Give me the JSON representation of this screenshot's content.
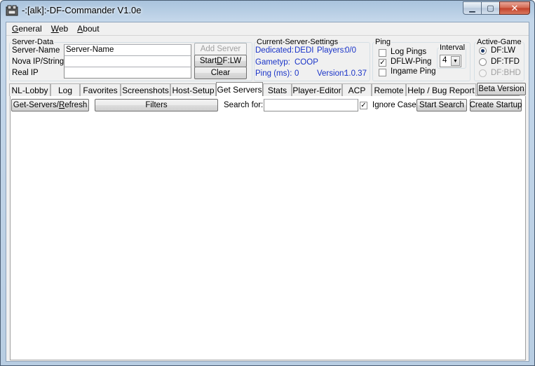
{
  "window": {
    "title": "-:[alk]:-DF-Commander V1.0e"
  },
  "menu": [
    {
      "pre": "",
      "u": "G",
      "post": "eneral"
    },
    {
      "pre": "",
      "u": "W",
      "post": "eb"
    },
    {
      "pre": "",
      "u": "A",
      "post": "bout"
    }
  ],
  "server_data": {
    "legend": "Server-Data",
    "name_label": "Server-Name",
    "name_value": "Server-Name",
    "nova_label": "Nova IP/String",
    "nova_value": "",
    "realip_label": "Real IP",
    "realip_value": "",
    "add_button": "Add Server",
    "start_button_pre": "Start ",
    "start_button_u": "D",
    "start_button_post": "F:LW",
    "clear_button": "Clear"
  },
  "current_server": {
    "legend": "Current-Server-Settings",
    "dedicated_label": "Dedicated:",
    "dedicated_value": "DEDI",
    "players_label": "Players:",
    "players_value": "0/0",
    "gametype_label": "Gametyp:",
    "gametype_value": "COOP",
    "ping_label": "Ping (ms):",
    "ping_value": "0",
    "version_label": "Version:",
    "version_value": "1.0.37"
  },
  "ping": {
    "legend": "Ping",
    "log_pings": "Log Pings",
    "dflw_ping": "DFLW-Ping",
    "ingame_ping": "Ingame Ping",
    "interval_legend": "Interval",
    "interval_value": "4"
  },
  "active_game": {
    "legend": "Active-Game",
    "options": [
      "DF:LW",
      "DF:TFD",
      "DF:BHD"
    ]
  },
  "tabs": [
    "NL-Lobby",
    "Log",
    "Favorites",
    "Screenshots",
    "Host-Setup",
    "Get Servers",
    "Stats",
    "Player-Editor",
    "ACP",
    "Remote",
    "Help / Bug Report"
  ],
  "beta_button": "Beta Version",
  "toolbar": {
    "refresh_pre": "Get-Servers/",
    "refresh_u": "R",
    "refresh_post": "efresh",
    "filters": "Filters",
    "search_label": "Search for:",
    "search_value": "",
    "ignore_case": "Ignore Case",
    "start_search": "Start Search",
    "create_startup": "Create Startup"
  }
}
